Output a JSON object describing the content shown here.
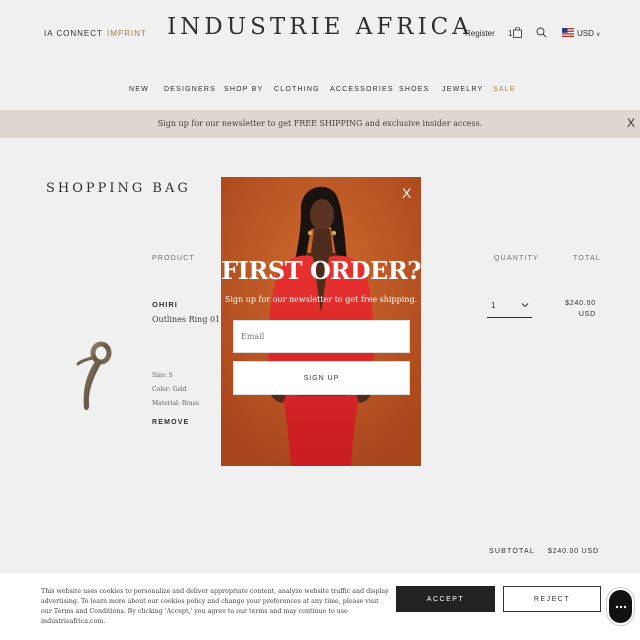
{
  "header": {
    "ia_connect": "IA CONNECT",
    "imprint": "IMPRINT",
    "brand": "INDUSTRIE AFRICA",
    "register": "Register",
    "bag_count": "1",
    "currency": "USD",
    "currency_caret": "∨"
  },
  "nav": [
    {
      "label": "NEW"
    },
    {
      "label": "DESIGNERS"
    },
    {
      "label": "SHOP BY"
    },
    {
      "label": "CLOTHING"
    },
    {
      "label": "ACCESSORIES"
    },
    {
      "label": "SHOES"
    },
    {
      "label": "JEWELRY"
    },
    {
      "label": "SALE"
    }
  ],
  "promo": {
    "text": "Sign up for our newsletter to get FREE SHIPPING and exclusive insider access.",
    "close": "X"
  },
  "bag": {
    "title": "SHOPPING BAG",
    "col_product": "PRODUCT",
    "col_quantity": "QUANTITY",
    "col_total": "TOTAL",
    "item": {
      "brand": "OHIRI",
      "name": "Outlines Ring 01",
      "size": "Size: S",
      "color": "Color: Gold",
      "material": "Material: Brass",
      "remove": "REMOVE",
      "quantity": "1",
      "price_line1": "$240.00",
      "price_line2": "USD"
    },
    "subtotal_label": "SUBTOTAL",
    "subtotal_value": "$240.00 USD"
  },
  "modal": {
    "close": "X",
    "title": "FIRST ORDER?",
    "subtitle": "Sign up for our newsletter to get free shipping.",
    "email_placeholder": "Email",
    "button": "SIGN UP"
  },
  "cookie": {
    "text": "This website uses cookies to personalize and deliver appropriate content, analyze website traffic and display advertising. To learn more about our cookies policy and change your preferences at any time, please visit our Terms and Conditions. By clicking 'Accept,' you agree to our terms and may continue to use industrieafrica.com.",
    "accept": "ACCEPT",
    "reject": "REJECT"
  },
  "colors": {
    "accent": "#b0894f",
    "promo_bg": "#ece5dd",
    "modal_bg": "#c05a25",
    "dress": "#e0262a"
  },
  "icons": [
    "shopping-bag-icon",
    "search-icon",
    "us-flag-icon",
    "chevron-down-icon",
    "close-icon",
    "chat-icon"
  ]
}
